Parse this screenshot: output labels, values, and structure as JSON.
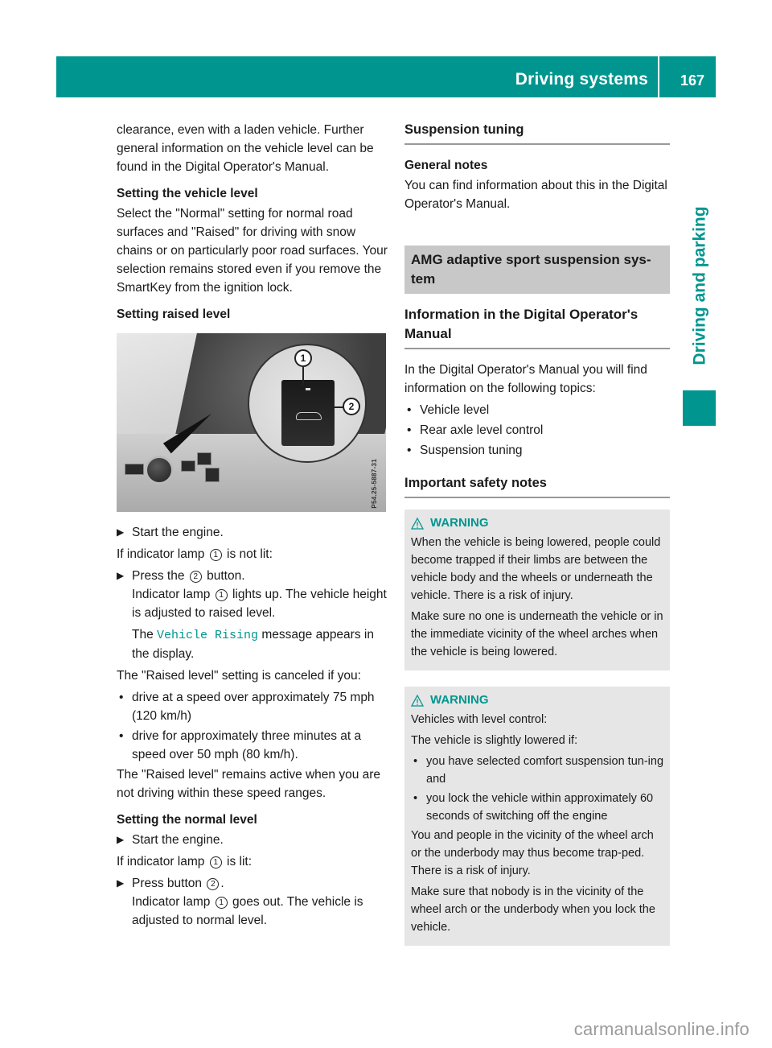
{
  "header": {
    "section_title": "Driving systems",
    "page_number": "167"
  },
  "side_tab": {
    "label": "Driving and parking"
  },
  "colors": {
    "accent": "#00968f",
    "banner_gray": "#c8c8c8",
    "warning_bg": "#e6e6e6"
  },
  "left": {
    "intro": "clearance, even with a laden vehicle. Further general information on the vehicle level can be found in the Digital Operator's Manual.",
    "vehicle_level_heading": "Setting the vehicle level",
    "vehicle_level_text": "Select the \"Normal\" setting for normal road surfaces and \"Raised\" for driving with snow chains or on particularly poor road surfaces. Your selection remains stored even if you remove the SmartKey from the ignition lock.",
    "raised_heading": "Setting raised level",
    "figure": {
      "callout_1": "1",
      "callout_2": "2",
      "image_code": "P54.25-5887-31"
    },
    "raised_step1": "Start the engine.",
    "raised_condition_pre": "If indicator lamp",
    "raised_condition_post": "is not lit:",
    "raised_step2_pre": "Press the",
    "raised_step2_post": "button.",
    "raised_result_pre": "Indicator lamp",
    "raised_result_post": "lights up. The vehicle height is adjusted to raised level.",
    "display_msg_pre": "The",
    "display_msg": "Vehicle Rising",
    "display_msg_post": "message appears in the display.",
    "canceled_intro": "The \"Raised level\" setting is canceled if you:",
    "canceled_bullets": [
      "drive at a speed over approximately 75 mph (120 km/h)",
      "drive for approximately three minutes at a speed over 50 mph (80 km/h)."
    ],
    "remains_active": "The \"Raised level\" remains active when you are not driving within these speed ranges.",
    "normal_heading": "Setting the normal level",
    "normal_step1": "Start the engine.",
    "normal_condition_pre": "If indicator lamp",
    "normal_condition_post": "is lit:",
    "normal_step2_pre": "Press button",
    "normal_step2_post": ".",
    "normal_result_pre": "Indicator lamp",
    "normal_result_post": "goes out. The vehicle is adjusted to normal level.",
    "num_1": "1",
    "num_2": "2"
  },
  "right": {
    "suspension_heading": "Suspension tuning",
    "general_notes_heading": "General notes",
    "general_notes_text": "You can find information about this in the Digital Operator's Manual.",
    "amg_banner": "AMG adaptive sport suspension sys-tem",
    "info_heading": "Information in the Digital Operator's Manual",
    "info_text": "In the Digital Operator's Manual you will find information on the following topics:",
    "topics": [
      "Vehicle level",
      "Rear axle level control",
      "Suspension tuning"
    ],
    "safety_heading": "Important safety notes",
    "warnings": [
      {
        "title": "WARNING",
        "paragraphs": [
          "When the vehicle is being lowered, people could become trapped if their limbs are between the vehicle body and the wheels or underneath the vehicle. There is a risk of injury.",
          "Make sure no one is underneath the vehicle or in the immediate vicinity of the wheel arches when the vehicle is being lowered."
        ]
      },
      {
        "title": "WARNING",
        "intro_1": "Vehicles with level control:",
        "intro_2": "The vehicle is slightly lowered if:",
        "bullets": [
          "you have selected comfort suspension tun-ing and",
          "you lock the vehicle within approximately 60 seconds of switching off the engine"
        ],
        "paragraphs": [
          "You and people in the vicinity of the wheel arch or the underbody may thus become trap-ped. There is a risk of injury.",
          "Make sure that nobody is in the vicinity of the wheel arch or the underbody when you lock the vehicle."
        ]
      }
    ]
  },
  "footer": {
    "watermark": "carmanualsonline.info"
  }
}
